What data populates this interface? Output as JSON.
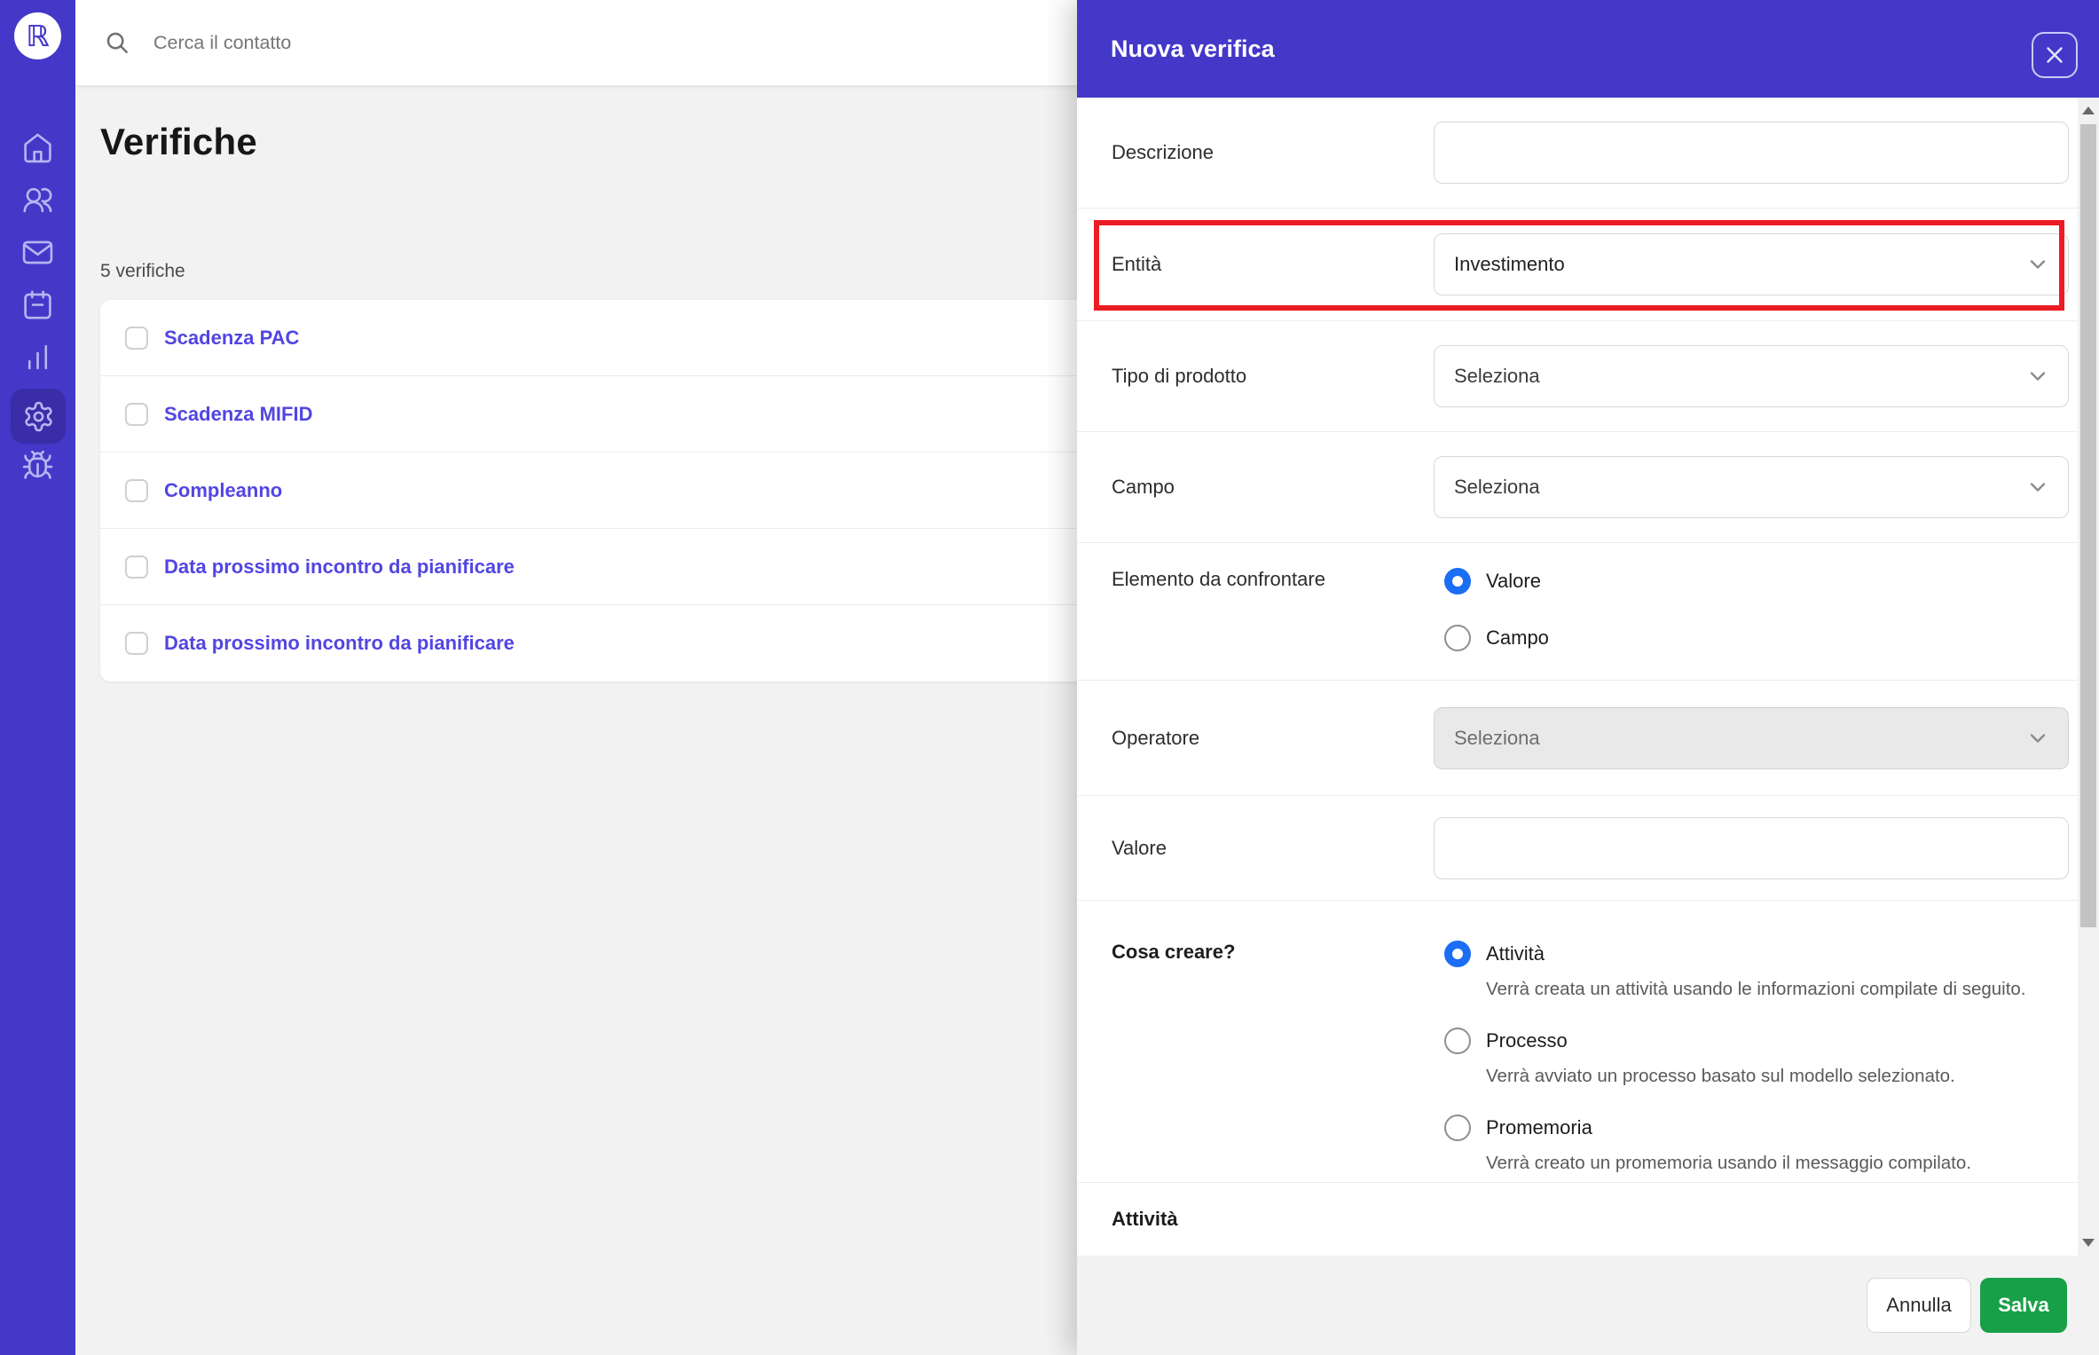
{
  "colors": {
    "purple": "#4438c9",
    "purple_dark": "#392da8",
    "icon": "#b7b5f2",
    "link": "#5146e1",
    "radio": "#1b6ef3",
    "green": "#18a048",
    "red": "#ec1c24"
  },
  "sidebar": {
    "logo": "ℝ",
    "icons": [
      "home",
      "users",
      "mail",
      "calendar",
      "bar-chart",
      "settings",
      "bug"
    ],
    "active_icon": "settings"
  },
  "topbar": {
    "search_placeholder": "Cerca il contatto"
  },
  "page": {
    "title": "Verifiche",
    "count_label": "5 verifiche",
    "items": [
      {
        "label": "Scadenza PAC"
      },
      {
        "label": "Scadenza MIFID"
      },
      {
        "label": "Compleanno"
      },
      {
        "label": "Data prossimo incontro da pianificare"
      },
      {
        "label": "Data prossimo incontro da pianificare"
      }
    ]
  },
  "drawer": {
    "title": "Nuova verifica",
    "fields": {
      "descrizione": {
        "label": "Descrizione",
        "value": ""
      },
      "entita": {
        "label": "Entità",
        "value": "Investimento",
        "highlighted": true
      },
      "tipo_prodotto": {
        "label": "Tipo di prodotto",
        "value": "Seleziona"
      },
      "campo": {
        "label": "Campo",
        "value": "Seleziona"
      },
      "elemento": {
        "label": "Elemento da confrontare",
        "options": [
          {
            "label": "Valore",
            "selected": true
          },
          {
            "label": "Campo",
            "selected": false
          }
        ]
      },
      "operatore": {
        "label": "Operatore",
        "value": "Seleziona",
        "disabled": true
      },
      "valore": {
        "label": "Valore",
        "value": ""
      },
      "cosa_creare": {
        "label": "Cosa creare?",
        "options": [
          {
            "label": "Attività",
            "description": "Verrà creata un attività usando le informazioni compilate di seguito.",
            "selected": true
          },
          {
            "label": "Processo",
            "description": "Verrà avviato un processo basato sul modello selezionato.",
            "selected": false
          },
          {
            "label": "Promemoria",
            "description": "Verrà creato un promemoria usando il messaggio compilato.",
            "selected": false
          }
        ]
      },
      "attivita_section": {
        "label": "Attività"
      }
    },
    "footer": {
      "cancel_label": "Annulla",
      "save_label": "Salva"
    }
  }
}
